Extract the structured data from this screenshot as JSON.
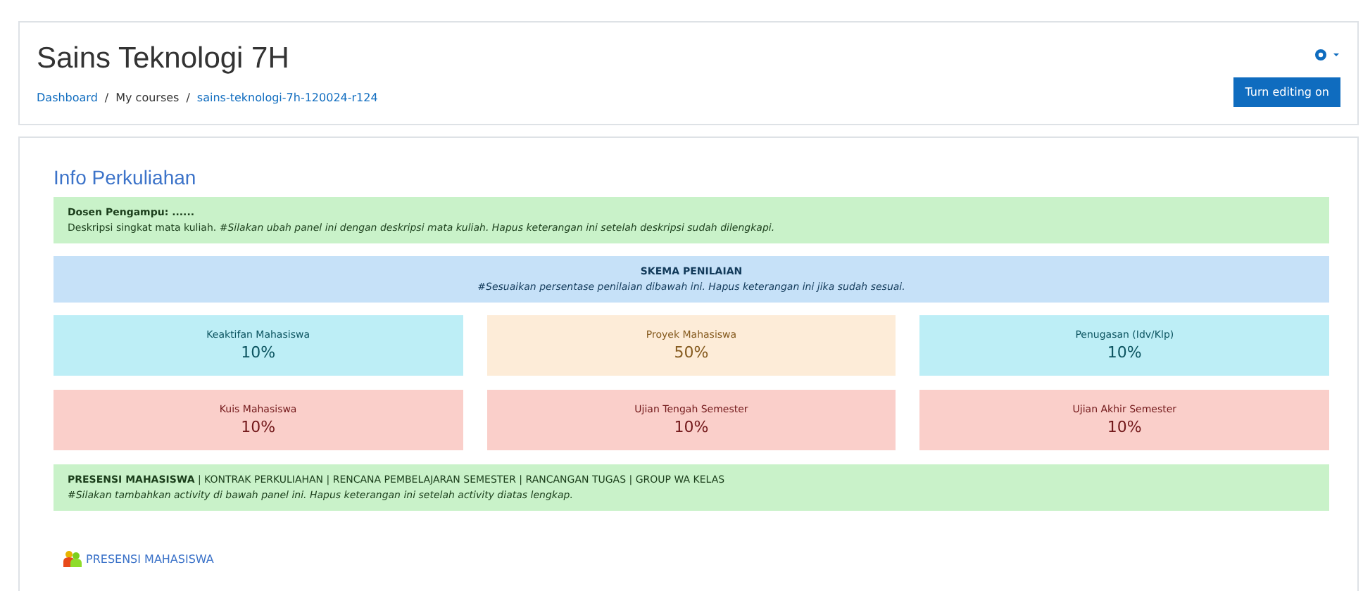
{
  "header": {
    "title": "Sains Teknologi 7H",
    "breadcrumb": [
      {
        "label": "Dashboard",
        "link": true
      },
      {
        "label": "My courses",
        "link": false
      },
      {
        "label": "sains-teknologi-7h-120024-r124",
        "link": true
      }
    ],
    "breadcrumb_separator": "/",
    "button": "Turn editing on"
  },
  "section": {
    "title": "Info Perkuliahan",
    "intro": {
      "heading": "Dosen Pengampu: ......",
      "text": "Deskripsi singkat mata kuliah. *#Silakan ubah panel ini dengan deskripsi mata kuliah. Hapus keterangan ini setelah deskripsi sudah dilengkapi.*"
    },
    "scheme": {
      "heading": "SKEMA PENILAIAN",
      "note": "#Sesuaikan persentase penilaian dibawah ini. Hapus keterangan ini jika sudah sesuai."
    },
    "tiles": [
      {
        "label": "Keaktifan Mahasiswa",
        "value": "10%",
        "kind": "info"
      },
      {
        "label": "Proyek Mahasiswa",
        "value": "50%",
        "kind": "warning"
      },
      {
        "label": "Penugasan (Idv/Klp)",
        "value": "10%",
        "kind": "info"
      },
      {
        "label": "Kuis Mahasiswa",
        "value": "10%",
        "kind": "danger"
      },
      {
        "label": "Ujian Tengah Semester",
        "value": "10%",
        "kind": "danger"
      },
      {
        "label": "Ujian Akhir Semester",
        "value": "10%",
        "kind": "danger"
      }
    ],
    "activities_panel": {
      "text": "**PRESENSI MAHASISWA** | KONTRAK PERKULIAHAN | RENCANA PEMBELAJARAN SEMESTER | RANCANGAN TUGAS | GROUP WA KELAS",
      "note": "#Silakan tambahkan activity di bawah panel ini. Hapus keterangan ini setelah activity diatas lengkap."
    },
    "activity": {
      "label": "PRESENSI MAHASISWA"
    }
  }
}
